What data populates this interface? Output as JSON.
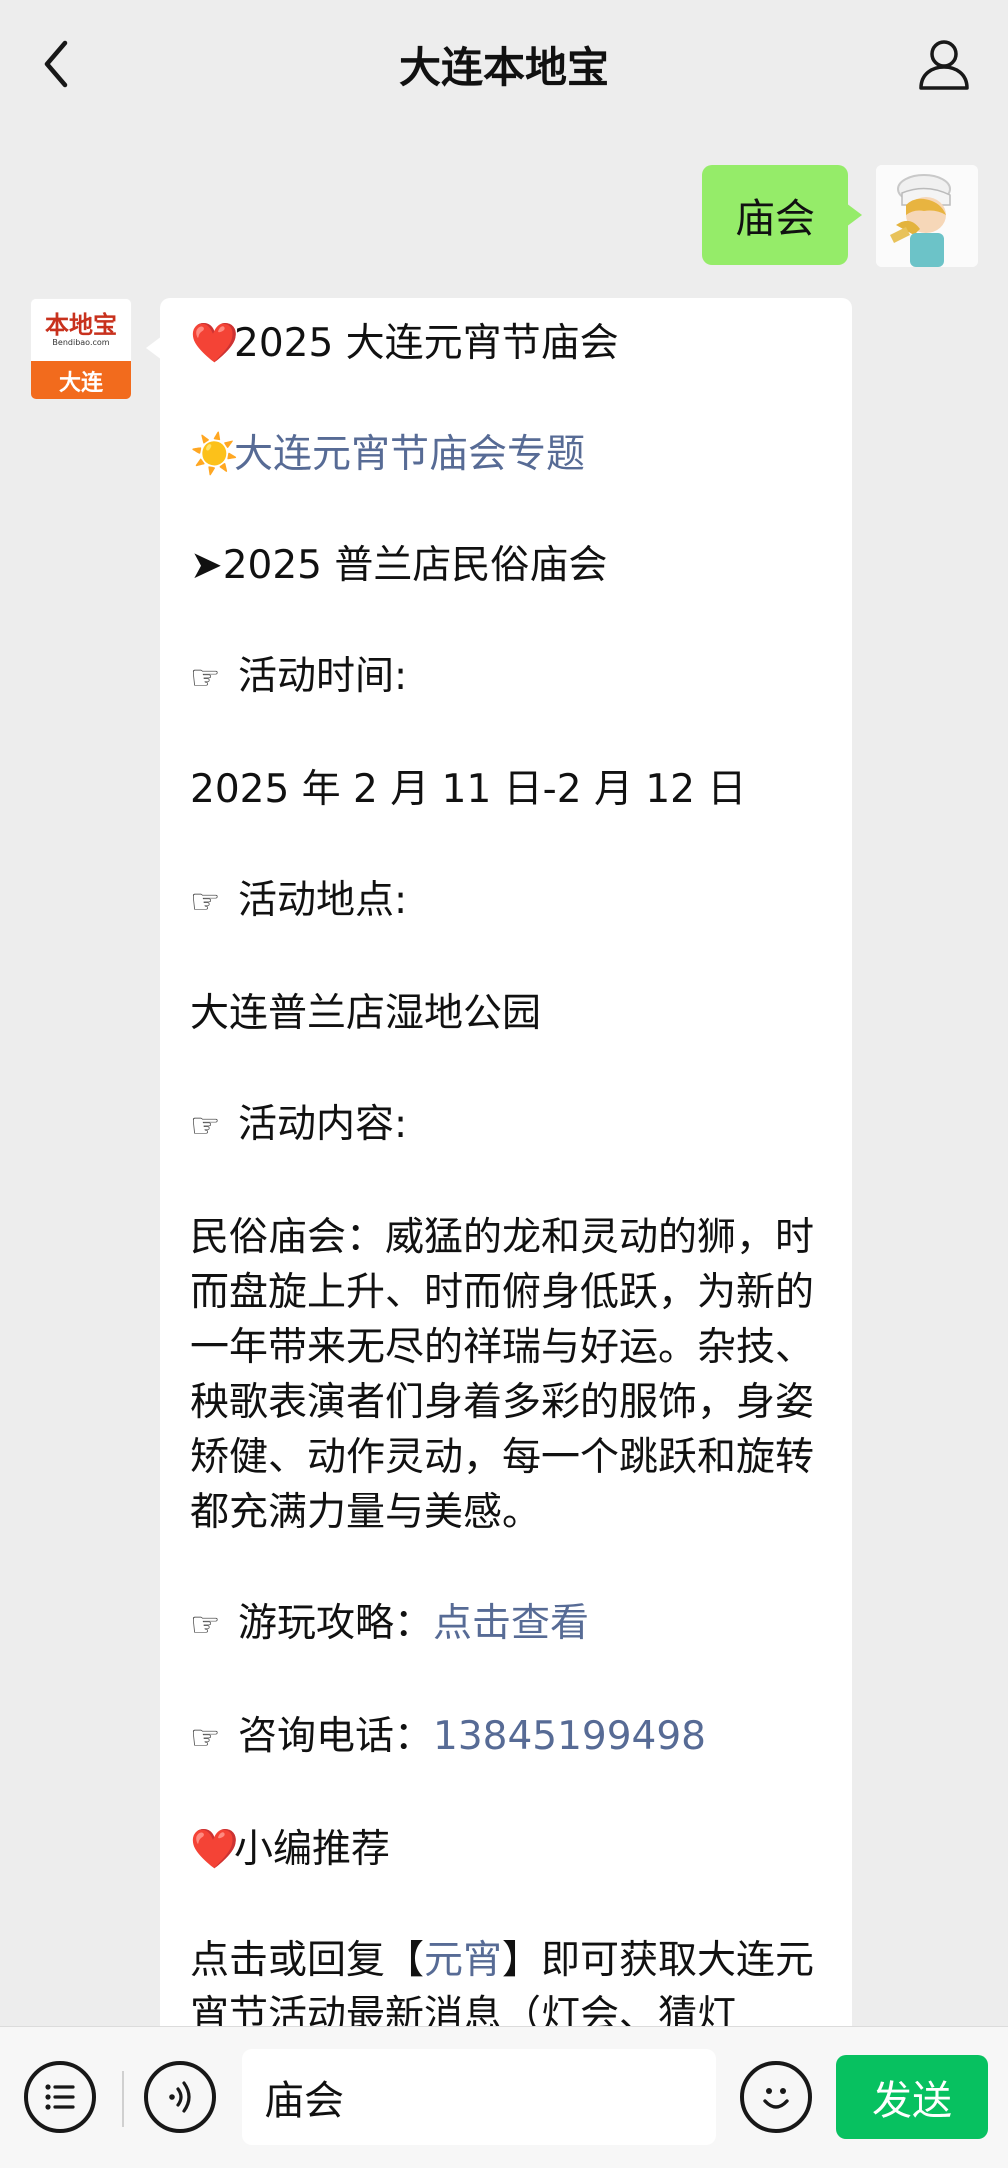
{
  "header": {
    "title": "大连本地宝"
  },
  "user_message": {
    "text": "庙会"
  },
  "bot": {
    "avatar_logo": "本地宝",
    "avatar_sub": "Bendibao.com",
    "avatar_city": "大连"
  },
  "bot_message": {
    "title_emoji": "❤️",
    "title": "2025 大连元宵节庙会",
    "topic_emoji": "☀️",
    "topic_link": "大连元宵节庙会专题",
    "arrow": "➤",
    "event_name": "2025 普兰店民俗庙会",
    "pointer": "☞",
    "time_label": "活动时间:",
    "time_value": "2025 年 2 月 11 日-2 月 12 日",
    "place_label": "活动地点:",
    "place_value": "大连普兰店湿地公园",
    "content_label": "活动内容:",
    "content_value": "民俗庙会：威猛的龙和灵动的狮，时而盘旋上升、时而俯身低跃，为新的一年带来无尽的祥瑞与好运。杂技、秧歌表演者们身着多彩的服饰，身姿矫健、动作灵动，每一个跳跃和旋转都充满力量与美感。",
    "guide_label": "游玩攻略：",
    "guide_link": "点击查看",
    "phone_label": "咨询电话：",
    "phone_link": "13845199498",
    "recommend_emoji": "❤️",
    "recommend": "小编推荐",
    "reply_prefix": "点击或回复【",
    "reply_keyword": "元宵",
    "reply_suffix": "】即可获取大连元宵节活动最新消息（灯会、猜灯"
  },
  "input_bar": {
    "input_value": "庙会",
    "send_label": "发送"
  },
  "colors": {
    "background": "#ededed",
    "user_bubble": "#95ec69",
    "link": "#576b95",
    "send_button": "#07c160"
  }
}
